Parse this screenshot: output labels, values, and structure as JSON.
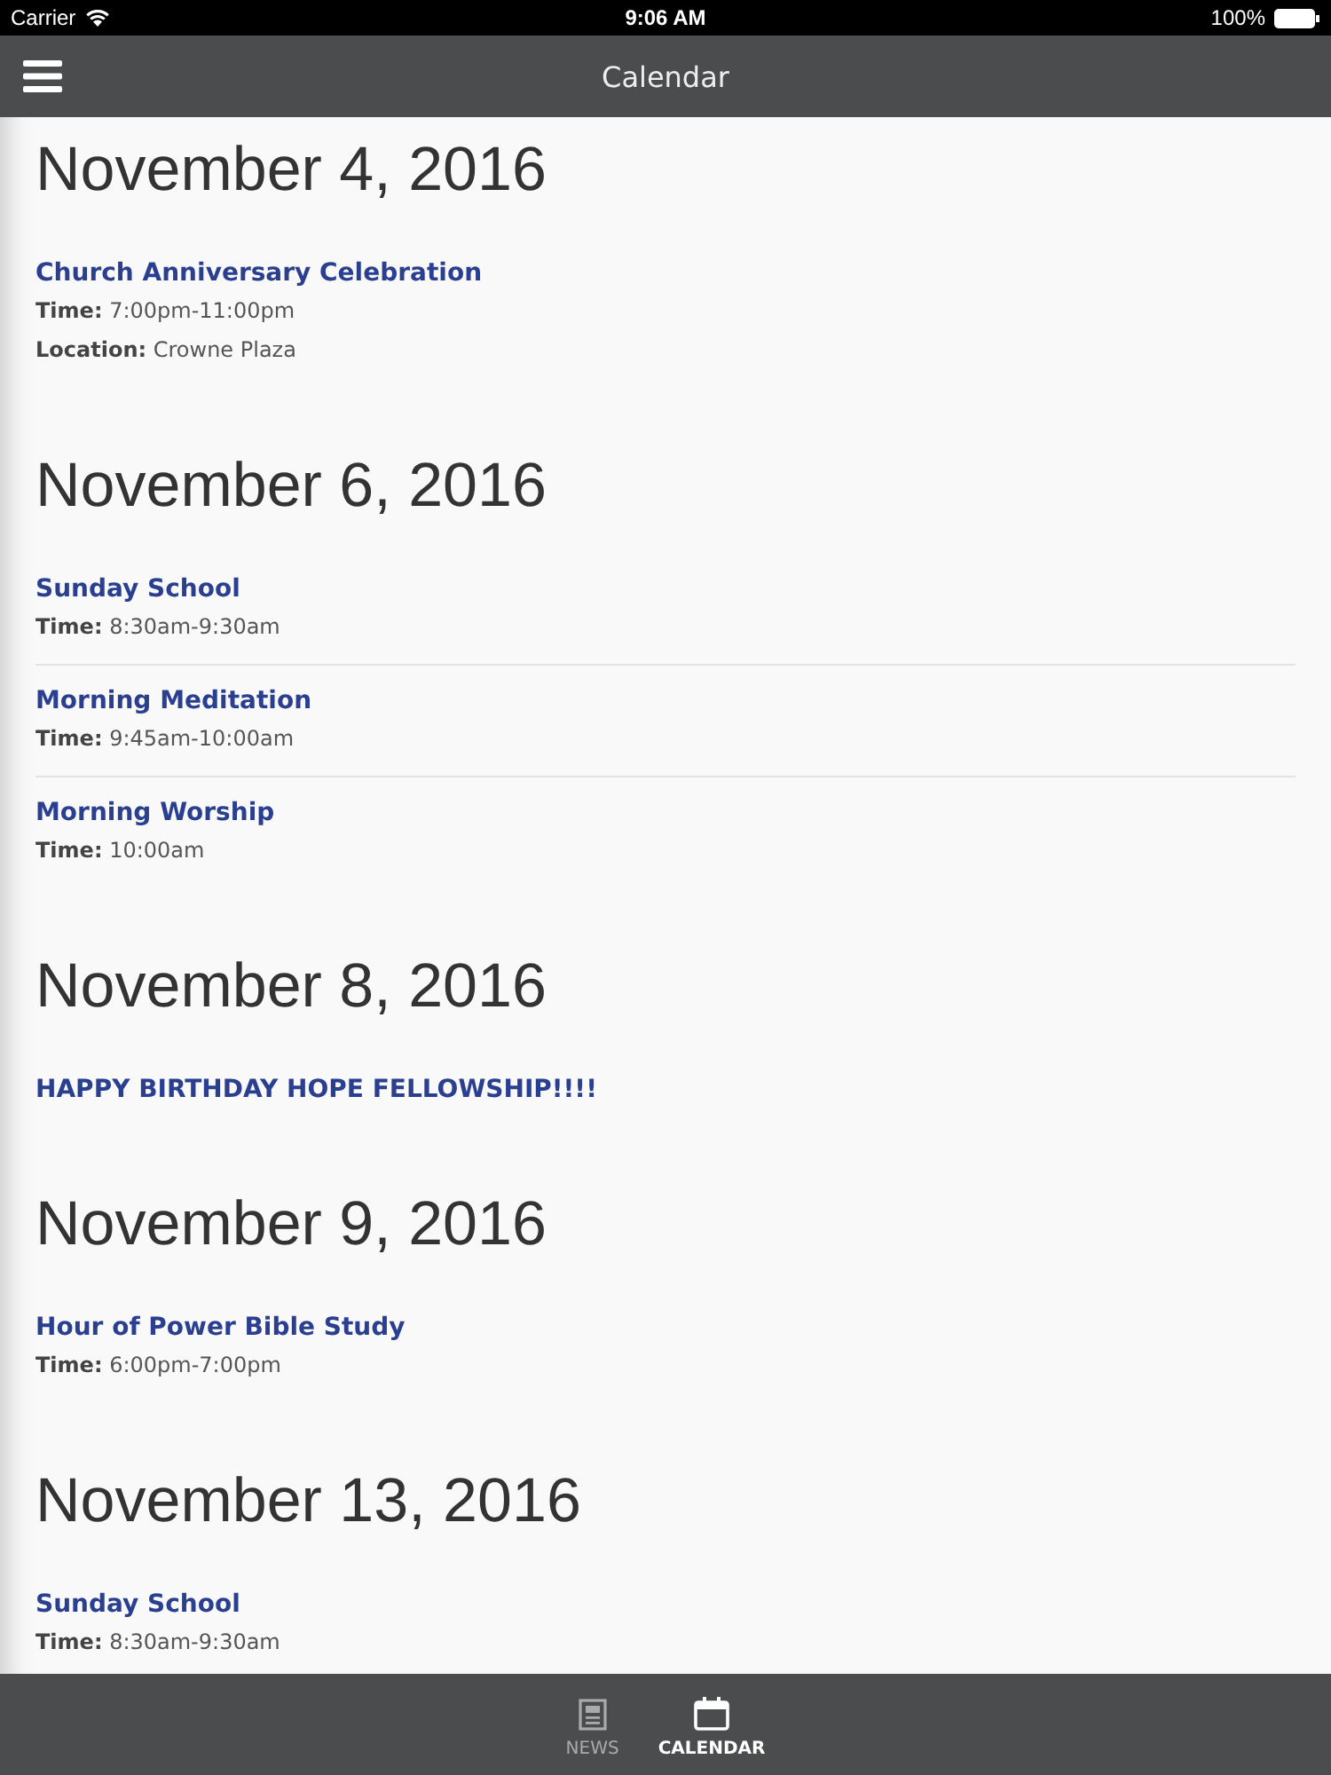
{
  "status_bar": {
    "carrier": "Carrier",
    "time": "9:06 AM",
    "battery": "100%"
  },
  "nav_bar": {
    "title": "Calendar"
  },
  "days": [
    {
      "date": "November 4, 2016",
      "events": [
        {
          "title": "Church Anniversary Celebration",
          "details": [
            "**Time:** 7:00pm-11:00pm",
            "**Location:** Crowne Plaza"
          ]
        }
      ]
    },
    {
      "date": "November 6, 2016",
      "events": [
        {
          "title": "Sunday School",
          "details": [
            "**Time:** 8:30am-9:30am"
          ]
        },
        {
          "title": "Morning Meditation",
          "details": [
            "**Time:** 9:45am-10:00am"
          ]
        },
        {
          "title": "Morning Worship",
          "details": [
            "**Time:** 10:00am"
          ]
        }
      ]
    },
    {
      "date": "November 8, 2016",
      "events": [
        {
          "title": "HAPPY BIRTHDAY HOPE FELLOWSHIP!!!!"
        }
      ]
    },
    {
      "date": "November 9, 2016",
      "events": [
        {
          "title": "Hour of Power Bible Study",
          "details": [
            "**Time:** 6:00pm-7:00pm"
          ]
        }
      ]
    },
    {
      "date": "November 13, 2016",
      "events": [
        {
          "title": "Sunday School",
          "details": [
            "**Time:** 8:30am-9:30am"
          ]
        }
      ]
    }
  ],
  "tab_bar": [
    {
      "kind": "news",
      "label": "NEWS",
      "selected": false
    },
    {
      "kind": "calendar",
      "label": "CALENDAR",
      "selected": true
    }
  ]
}
